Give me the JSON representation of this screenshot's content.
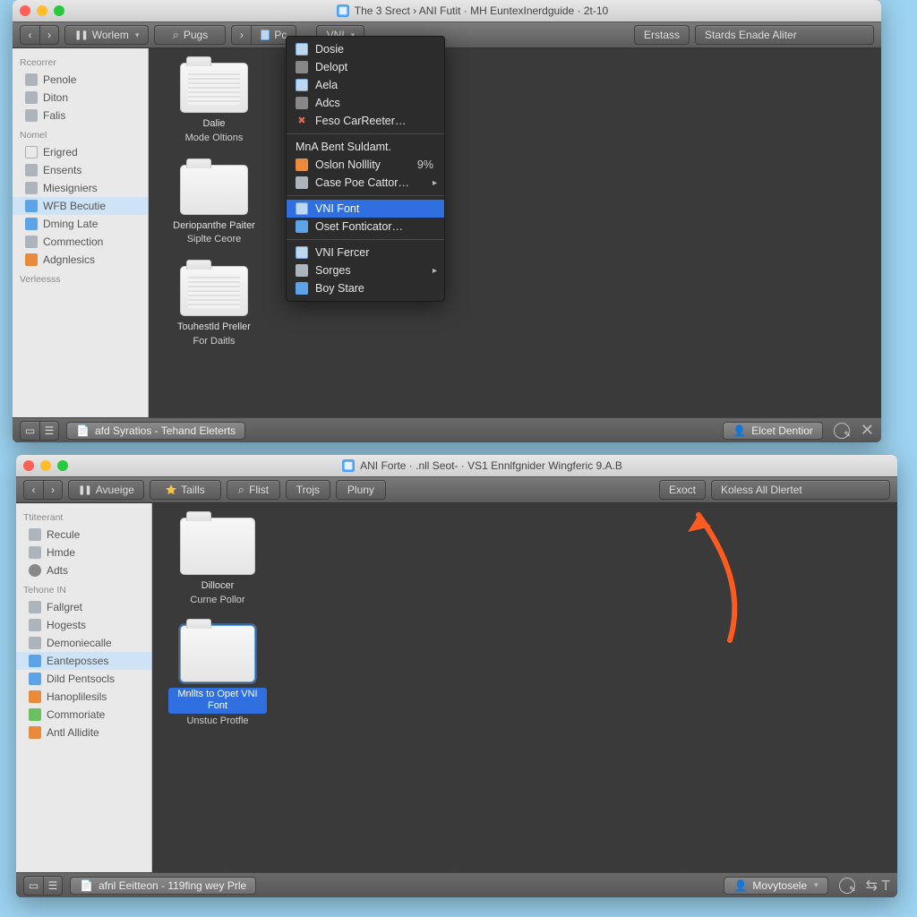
{
  "window1": {
    "title": "The 3 Srect › ANI Futit · MH EuntexInerdguide · 2t-10",
    "toolbar": {
      "back": "‹",
      "forward": "›",
      "pause": "❚❚",
      "violent": "Worlem",
      "pugs": "Pugs",
      "caret": "›",
      "pc": "Pc",
      "vni": "VNI",
      "erstass": "Erstass",
      "starde": "Stards Enade Aliter"
    },
    "sidebar": {
      "h1": "Rceorrer",
      "g1": [
        {
          "label": "Penole"
        },
        {
          "label": "Diton"
        },
        {
          "label": "Falis"
        }
      ],
      "h2": "Nomel",
      "g2": [
        {
          "label": "Erigred"
        },
        {
          "label": "Ensents"
        },
        {
          "label": "Miesigniers"
        },
        {
          "label": "WFB Becutie",
          "sel": true
        },
        {
          "label": "Dming Late"
        },
        {
          "label": "Commection"
        },
        {
          "label": "Adgnlesics"
        }
      ],
      "h3": "Verleesss"
    },
    "items": [
      {
        "line1": "Dalie",
        "line2": "Mode Oltions",
        "thumb": true
      },
      {
        "line1": "Deriopanthe Paiter",
        "line2": "Siplte Ceore"
      },
      {
        "line1": "Touhestld Preller",
        "line2": "For Daitls",
        "thumb": true
      }
    ],
    "menu": {
      "g1": [
        {
          "label": "Dosie",
          "ic": "ic-page"
        },
        {
          "label": "Delopt",
          "ic": "ic-blk"
        },
        {
          "label": "Aela",
          "ic": "ic-page"
        },
        {
          "label": "Adcs",
          "ic": "sb-gear"
        },
        {
          "label": "Feso CarReeter…",
          "ic": "ic-redx",
          "red": true
        }
      ],
      "g2": [
        {
          "label": "MnA Bent Suldamt.",
          "noicon": true
        },
        {
          "label": "Oslon Nolllity",
          "ic": "sb-orange",
          "pct": "9%"
        },
        {
          "label": "Case Poe Cattor…",
          "ic": "sb-gray",
          "arrow": true
        }
      ],
      "g3": [
        {
          "label": "VNI Font",
          "ic": "ic-page",
          "sel": true
        },
        {
          "label": "Oset Fonticator…",
          "ic": "sb-blue"
        }
      ],
      "g4": [
        {
          "label": "VNI Fercer",
          "ic": "ic-page"
        },
        {
          "label": "Sorges",
          "ic": "sb-gray",
          "arrow": true
        },
        {
          "label": "Boy Stare",
          "ic": "sb-blue"
        }
      ]
    },
    "status": {
      "path": "afd Syratios - Tehand Eleterts",
      "user": "Elcet Dentior"
    }
  },
  "window2": {
    "title": "ANI Forte · .nll Seot‑ · VS1 Ennlfgnider Wingferic 9.A.B",
    "toolbar": {
      "avueige": "Avueige",
      "taills": "Taills",
      "flist": "Flist",
      "trots": "Trojs",
      "pluny": "Pluny",
      "exact": "Exoct",
      "koless": "Koless All Dlertet"
    },
    "sidebar": {
      "h1": "Ttiteerant",
      "g1": [
        {
          "label": "Recule"
        },
        {
          "label": "Hmde"
        },
        {
          "label": "Adts"
        }
      ],
      "h2": "Tehone IN",
      "g2": [
        {
          "label": "Fallgret"
        },
        {
          "label": "Hogests"
        },
        {
          "label": "Demoniecalle"
        },
        {
          "label": "Eanteposses",
          "sel": true
        },
        {
          "label": "Dild Pentsocls"
        },
        {
          "label": "Hanoplilesils"
        },
        {
          "label": "Commoriate"
        },
        {
          "label": "Antl Allidite"
        }
      ]
    },
    "items": [
      {
        "line1": "Dillocer",
        "line2": "Curne Pollor"
      },
      {
        "line1": "Mnllts to Opet VNI Font",
        "line2": "Unstuc Protfle",
        "sel": true
      }
    ],
    "status": {
      "path": "afnl Eeitteon - 119fing wey Prle",
      "user": "Movytosele"
    }
  }
}
